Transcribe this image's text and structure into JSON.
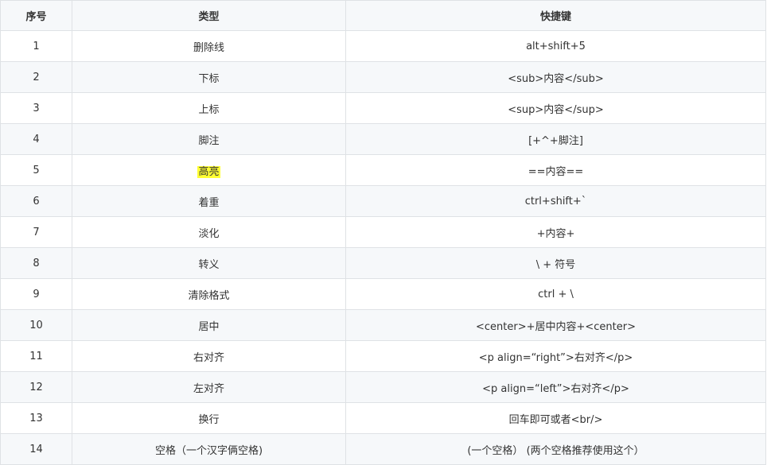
{
  "table": {
    "headers": [
      "序号",
      "类型",
      "快捷键"
    ],
    "rows": [
      {
        "index": "1",
        "type": "删除线",
        "shortcut": "alt+shift+5"
      },
      {
        "index": "2",
        "type": "下标",
        "shortcut": "<sub>内容</sub>"
      },
      {
        "index": "3",
        "type": "上标",
        "shortcut": "<sup>内容</sup>"
      },
      {
        "index": "4",
        "type": "脚注",
        "shortcut": "[+^+脚注]"
      },
      {
        "index": "5",
        "type": "高亮",
        "shortcut": "==内容==",
        "highlight": true
      },
      {
        "index": "6",
        "type": "着重",
        "shortcut": "ctrl+shift+`"
      },
      {
        "index": "7",
        "type": "淡化",
        "shortcut": "+内容+"
      },
      {
        "index": "8",
        "type": "转义",
        "shortcut": "\\ + 符号"
      },
      {
        "index": "9",
        "type": "清除格式",
        "shortcut": "ctrl + \\"
      },
      {
        "index": "10",
        "type": "居中",
        "shortcut": "<center>+居中内容+<center>"
      },
      {
        "index": "11",
        "type": "右对齐",
        "shortcut": "<p align=“right”>右对齐</p>"
      },
      {
        "index": "12",
        "type": "左对齐",
        "shortcut": "<p align=“left”>右对齐</p>"
      },
      {
        "index": "13",
        "type": "换行",
        "shortcut": "回车即可或者<br/>"
      },
      {
        "index": "14",
        "type": "空格（一个汉字俩空格)",
        "shortcut": "(一个空格） (两个空格推荐使用这个）"
      }
    ]
  },
  "colors": {
    "highlight": "#ffff33",
    "stripe": "#f6f8fa",
    "border": "#dfe2e5",
    "text": "#333333"
  }
}
